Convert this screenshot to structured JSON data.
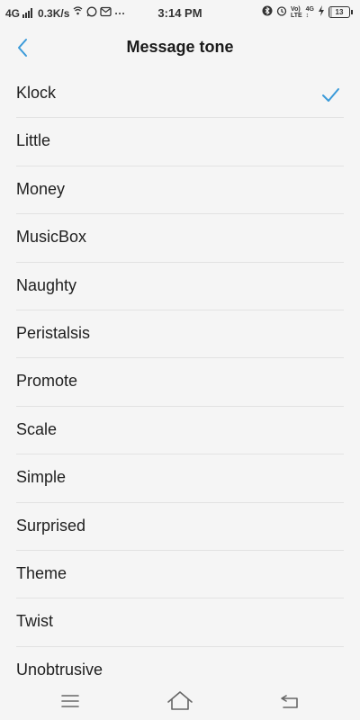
{
  "status_bar": {
    "network": "4G",
    "speed": "0.3K/s",
    "overflow": "···",
    "time": "3:14 PM",
    "volte_top": "Vo)",
    "volte_bottom": "LTE",
    "data_net_top": "4G",
    "data_net_bottom": "↕",
    "battery_level": "13",
    "battery_fraction": 0.13
  },
  "header": {
    "title": "Message tone",
    "back_icon": "chevron-left-icon"
  },
  "accent_color": "#3a9ad9",
  "selected_tone": "Klock",
  "tones": [
    {
      "label": "Klock"
    },
    {
      "label": "Little"
    },
    {
      "label": "Money"
    },
    {
      "label": "MusicBox"
    },
    {
      "label": "Naughty"
    },
    {
      "label": "Peristalsis"
    },
    {
      "label": "Promote"
    },
    {
      "label": "Scale"
    },
    {
      "label": "Simple"
    },
    {
      "label": "Surprised"
    },
    {
      "label": "Theme"
    },
    {
      "label": "Twist"
    },
    {
      "label": "Unobtrusive"
    }
  ],
  "nav_bar": {
    "menu_icon": "menu-icon",
    "home_icon": "home-icon",
    "back_icon": "back-icon"
  }
}
